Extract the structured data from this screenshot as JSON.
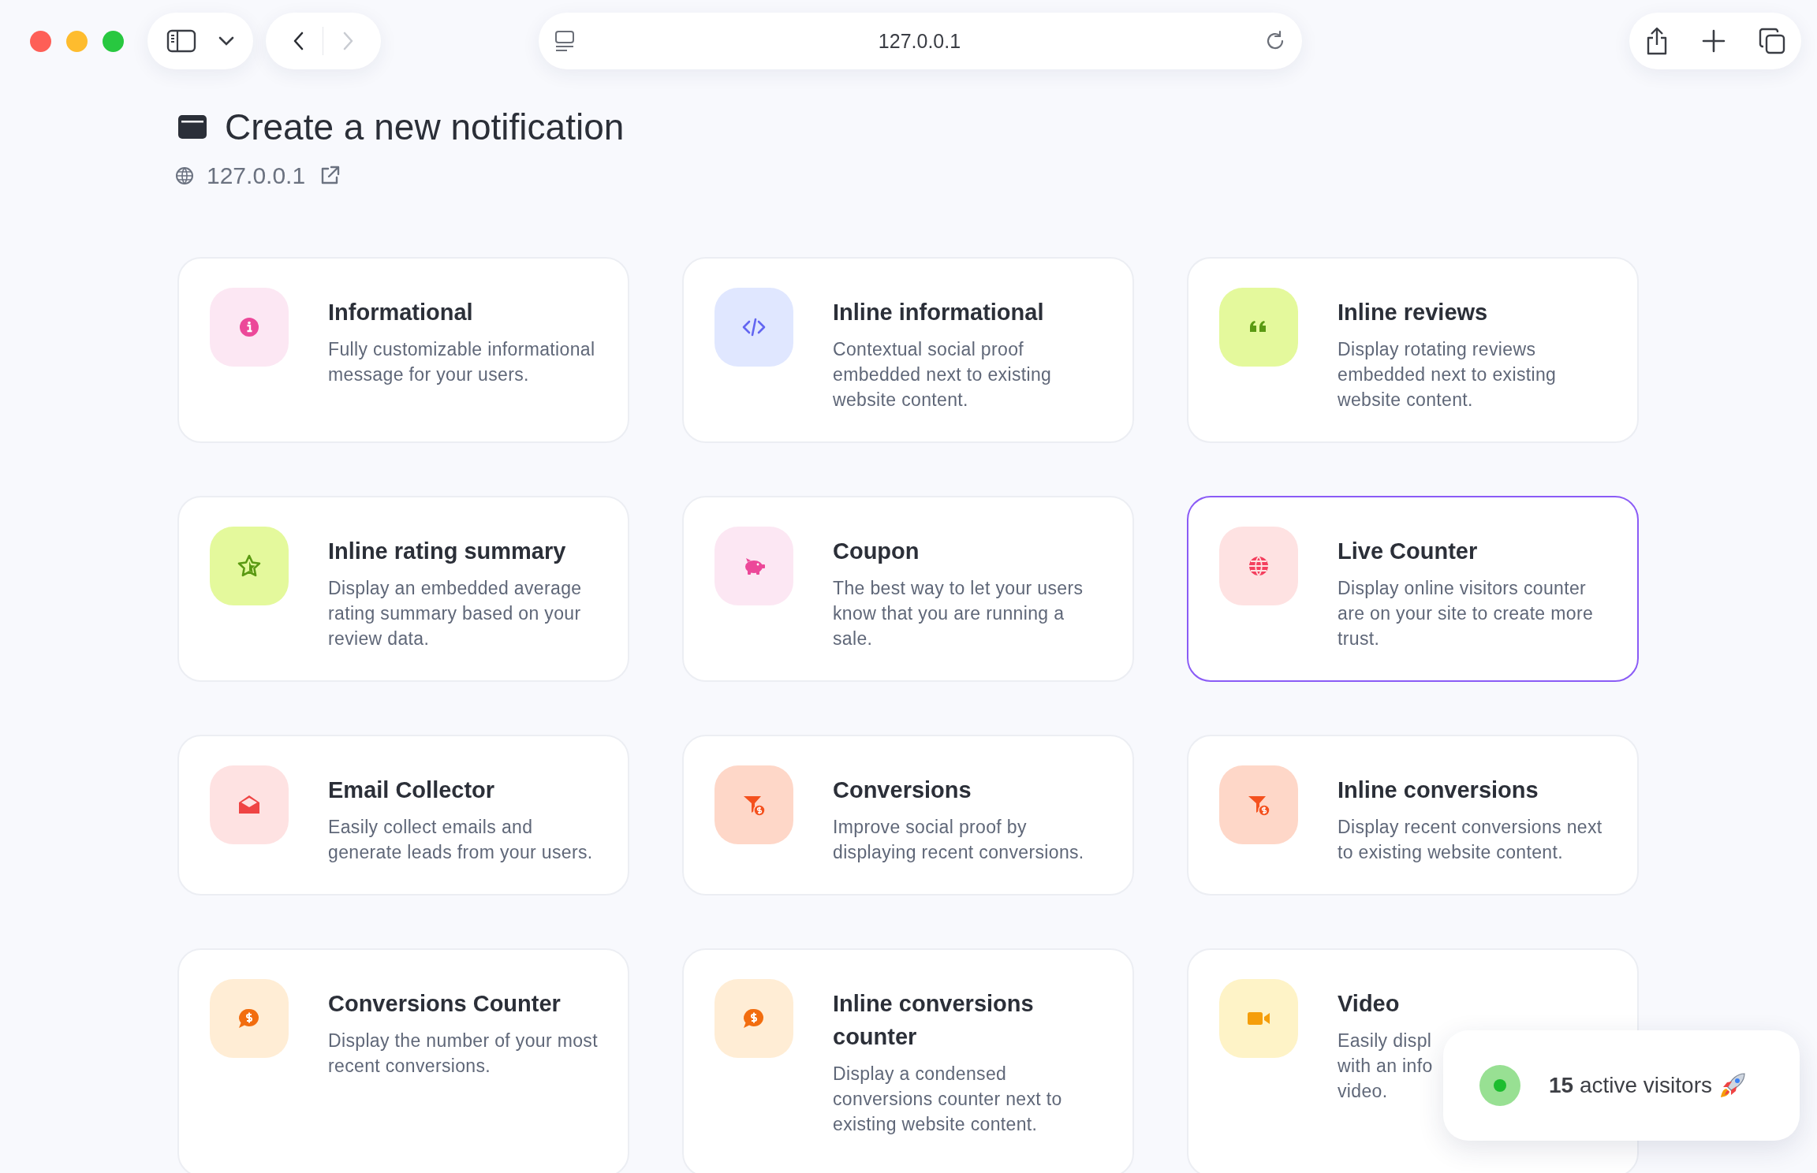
{
  "browser": {
    "address": "127.0.0.1",
    "navigation": [
      {
        "kind": "back",
        "disabled": false
      },
      {
        "kind": "forward",
        "disabled": true
      }
    ]
  },
  "header": {
    "title": "Create a new notification",
    "site": "127.0.0.1"
  },
  "cards": [
    {
      "title": "Informational",
      "description": "Fully customizable informational message for your users.",
      "selected": false
    },
    {
      "title": "Inline informational",
      "description": "Contextual social proof embedded next to existing website content.",
      "selected": false
    },
    {
      "title": "Inline reviews",
      "description": "Display rotating reviews embedded next to existing website content.",
      "selected": false
    },
    {
      "title": "Inline rating summary",
      "description": "Display an embedded average rating summary based on your review data.",
      "selected": false
    },
    {
      "title": "Coupon",
      "description": "The best way to let your users know that you are running a sale.",
      "selected": false
    },
    {
      "title": "Live Counter",
      "description": "Display online visitors counter are on your site to create more trust.",
      "selected": true
    },
    {
      "title": "Email Collector",
      "description": "Easily collect emails and generate leads from your users.",
      "selected": false
    },
    {
      "title": "Conversions",
      "description": "Improve social proof by displaying recent conversions.",
      "selected": false
    },
    {
      "title": "Inline conversions",
      "description": "Display recent conversions next to existing website content.",
      "selected": false
    },
    {
      "title": "Conversions Counter",
      "description": "Display the number of your most recent conversions.",
      "selected": false
    },
    {
      "title": "Inline conversions counter",
      "description": "Display a condensed conversions counter next to existing website content.",
      "selected": false
    },
    {
      "title": "Video",
      "description": "Easily displ\nwith an info\nvideo.",
      "selected": false
    }
  ],
  "toast": {
    "text": "**15** active visitors"
  }
}
